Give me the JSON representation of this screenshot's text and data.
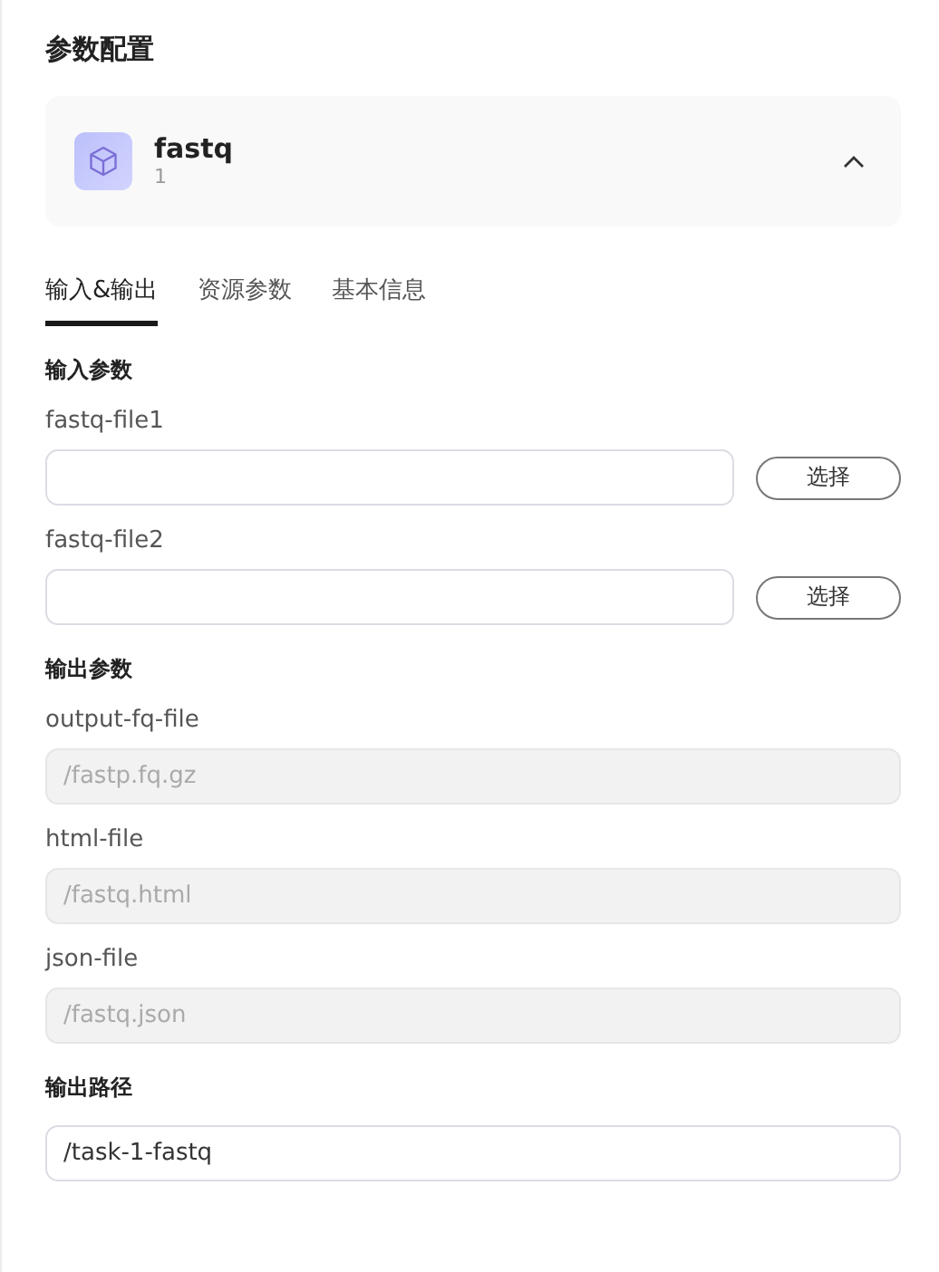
{
  "title": "参数配置",
  "node": {
    "name": "fastq",
    "subtitle": "1",
    "expanded": true
  },
  "tabs": [
    {
      "label": "输入&输出",
      "selected": true
    },
    {
      "label": "资源参数",
      "selected": false
    },
    {
      "label": "基本信息",
      "selected": false
    }
  ],
  "sections": [
    {
      "heading": "输入参数",
      "fields": [
        {
          "kind": "file",
          "label": "fastq-file1",
          "disabled": false,
          "button": "选择"
        },
        {
          "kind": "file",
          "label": "fastq-file2",
          "disabled": false,
          "button": "选择"
        }
      ]
    },
    {
      "heading": "输出参数",
      "fields": [
        {
          "kind": "text",
          "label": "output-fq-file",
          "value": "/fastp.fq.gz",
          "disabled": true
        },
        {
          "kind": "text",
          "label": "html-file",
          "value": "/fastq.html",
          "disabled": true
        },
        {
          "kind": "text",
          "label": "json-file",
          "value": "/fastq.json",
          "disabled": true
        }
      ]
    },
    {
      "heading": "输出路径",
      "fields": [
        {
          "kind": "text",
          "value": "/task-1-fastq",
          "disabled": false
        }
      ]
    }
  ]
}
